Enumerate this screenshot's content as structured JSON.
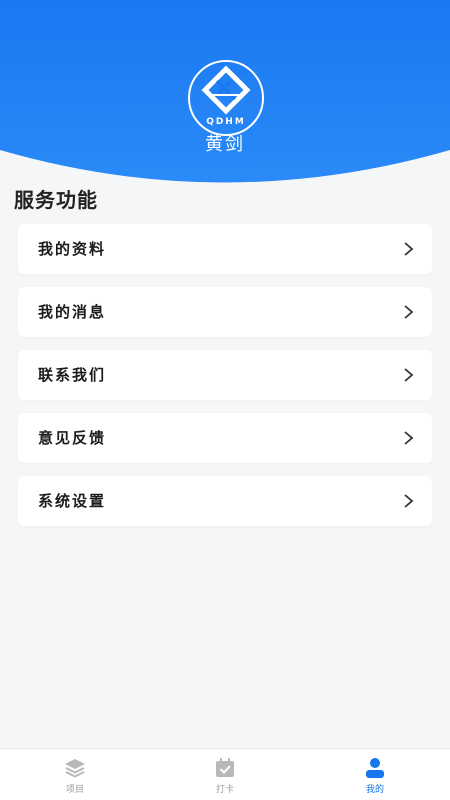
{
  "profile": {
    "logo_text": "QDHM",
    "username": "黄剑"
  },
  "services": {
    "title": "服务功能",
    "items": [
      {
        "label": "我的资料"
      },
      {
        "label": "我的消息"
      },
      {
        "label": "联系我们"
      },
      {
        "label": "意见反馈"
      },
      {
        "label": "系统设置"
      }
    ]
  },
  "tabbar": {
    "tabs": [
      {
        "label": "项目",
        "icon": "layers-icon"
      },
      {
        "label": "打卡",
        "icon": "calendar-check-icon"
      },
      {
        "label": "我的",
        "icon": "user-icon",
        "active": true
      }
    ]
  },
  "colors": {
    "header_blue": "#1b7cf2",
    "active_tab": "#1677ee",
    "background": "#f5f6f8"
  }
}
